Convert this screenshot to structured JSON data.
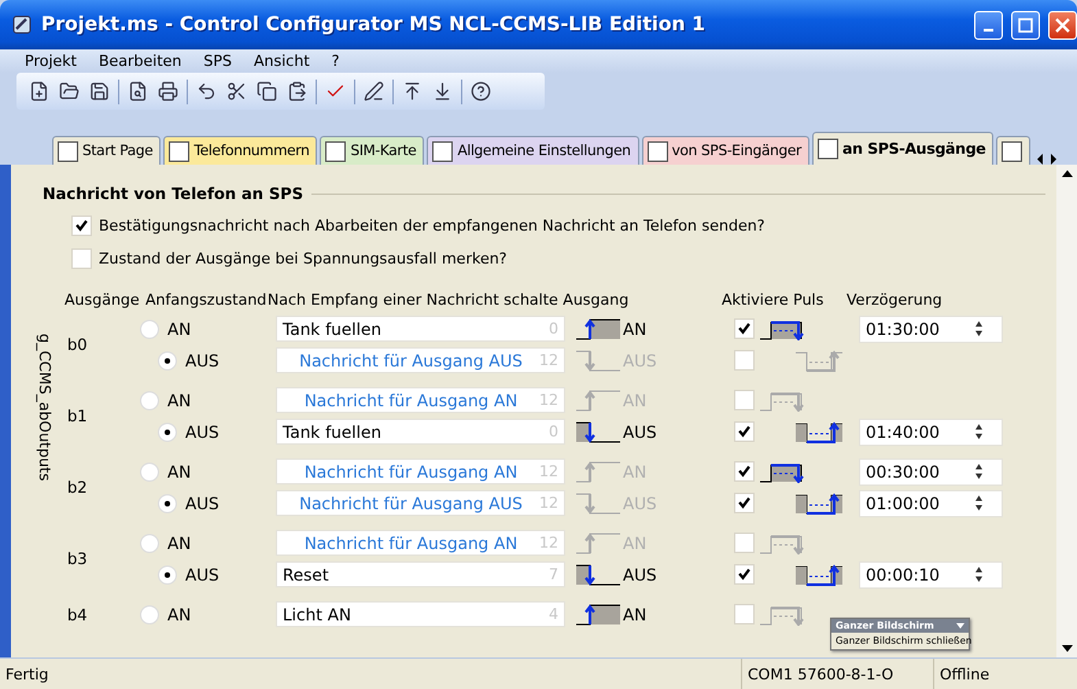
{
  "window": {
    "title": "Projekt.ms - Control Configurator MS NCL-CCMS-LIB Edition 1"
  },
  "menu": [
    "Projekt",
    "Bearbeiten",
    "SPS",
    "Ansicht",
    "?"
  ],
  "tabs": [
    {
      "label": "Start Page",
      "selected": false,
      "color": "#ece9d8"
    },
    {
      "label": "Telefonnummern",
      "selected": false,
      "color": "#fbe99a"
    },
    {
      "label": "SIM-Karte",
      "selected": false,
      "color": "#d8ecc8"
    },
    {
      "label": "Allgemeine Einstellungen",
      "selected": false,
      "color": "#dcd4f0"
    },
    {
      "label": "von SPS-Eingänger",
      "selected": false,
      "color": "#f6d0d0"
    },
    {
      "label": "an SPS-Ausgänge",
      "selected": true,
      "color": "#ece9d8"
    }
  ],
  "section": {
    "title": "Nachricht von Telefon an SPS",
    "options": [
      {
        "label": "Bestätigungsnachricht nach Abarbeiten der empfangenen Nachricht an Telefon senden?",
        "checked": true
      },
      {
        "label": "Zustand der Ausgänge bei Spannungsausfall merken?",
        "checked": false
      }
    ]
  },
  "columns": [
    "Ausgänge",
    "Anfangszustand",
    "Nach Empfang einer Nachricht schalte Ausgang",
    "Aktiviere Puls",
    "Verzögerung"
  ],
  "group_label": "g_CCMS_abOutputs",
  "outputs": [
    {
      "name": "b0",
      "states": [
        {
          "kind": "on",
          "label": "AN",
          "selected": false,
          "message": "Tank fuellen",
          "active": true,
          "count": "0",
          "signal": "AN",
          "pulse": true,
          "delay": "01:30:00"
        },
        {
          "kind": "off",
          "label": "AUS",
          "selected": true,
          "message": "Nachricht für Ausgang AUS",
          "active": false,
          "count": "12",
          "signal": "AUS",
          "pulse": false
        }
      ]
    },
    {
      "name": "b1",
      "states": [
        {
          "kind": "on",
          "label": "AN",
          "selected": false,
          "message": "Nachricht für Ausgang AN",
          "active": false,
          "count": "12",
          "signal": "AN",
          "pulse": false
        },
        {
          "kind": "off",
          "label": "AUS",
          "selected": true,
          "message": "Tank fuellen",
          "active": true,
          "count": "0",
          "signal": "AUS",
          "pulse": true,
          "delay": "01:40:00"
        }
      ]
    },
    {
      "name": "b2",
      "states": [
        {
          "kind": "on",
          "label": "AN",
          "selected": false,
          "message": "Nachricht für Ausgang AN",
          "active": false,
          "count": "12",
          "signal": "AN",
          "pulse": true,
          "delay": "00:30:00"
        },
        {
          "kind": "off",
          "label": "AUS",
          "selected": true,
          "message": "Nachricht für Ausgang AUS",
          "active": false,
          "count": "12",
          "signal": "AUS",
          "pulse": true,
          "delay": "01:00:00"
        }
      ]
    },
    {
      "name": "b3",
      "states": [
        {
          "kind": "on",
          "label": "AN",
          "selected": false,
          "message": "Nachricht für Ausgang AN",
          "active": false,
          "count": "12",
          "signal": "AN",
          "pulse": false
        },
        {
          "kind": "off",
          "label": "AUS",
          "selected": true,
          "message": "Reset",
          "active": true,
          "count": "7",
          "signal": "AUS",
          "pulse": true,
          "delay": "00:00:10"
        }
      ]
    },
    {
      "name": "b4",
      "states": [
        {
          "kind": "on",
          "label": "AN",
          "selected": false,
          "message": "Licht AN",
          "active": true,
          "count": "4",
          "signal": "AN",
          "pulse": false
        }
      ]
    }
  ],
  "popup": {
    "title": "Ganzer Bildschirm",
    "item": "Ganzer Bildschirm schließen"
  },
  "status_bar": [
    "Fertig",
    "COM1 57600-8-1-O",
    "Offline"
  ]
}
